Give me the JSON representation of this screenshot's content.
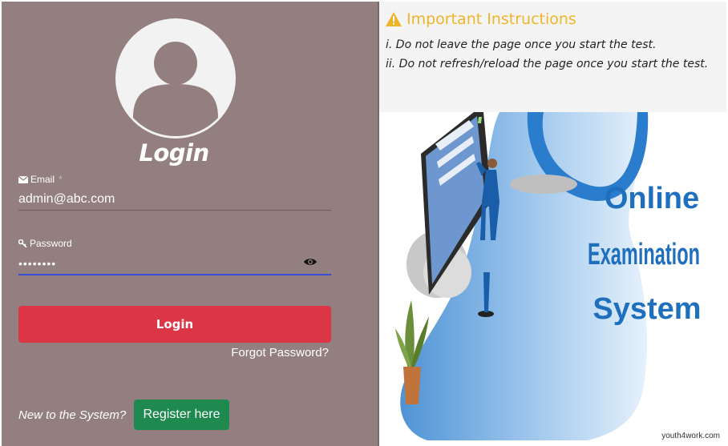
{
  "login_form": {
    "title": "Login",
    "email_label": "Email",
    "email_required": "*",
    "email_value": "admin@abc.com",
    "password_label": "Password",
    "password_masked": "••••••••",
    "login_button_label": "Login",
    "forgot_password_label": "Forgot Password?",
    "new_to_system_text": "New to the System?",
    "register_button_label": "Register here"
  },
  "instructions": {
    "title": "Important Instructions",
    "items": [
      "i. Do not leave the page once you start the test.",
      "ii. Do not refresh/reload the page once you start the test."
    ]
  },
  "illustration": {
    "heading_lines": [
      "Online",
      "Examination",
      "System"
    ],
    "watermark": "youth4work.com"
  },
  "colors": {
    "left_panel_bg": "#937f7f",
    "login_button": "#dc3545",
    "register_button": "#1e8a4f",
    "instructions_title": "#f0b429",
    "illustration_text": "#1f6fbf"
  },
  "icons": {
    "avatar": "user-avatar-icon",
    "email": "envelope-icon",
    "password": "key-icon",
    "show_password": "eye-icon",
    "warning": "warning-icon"
  }
}
